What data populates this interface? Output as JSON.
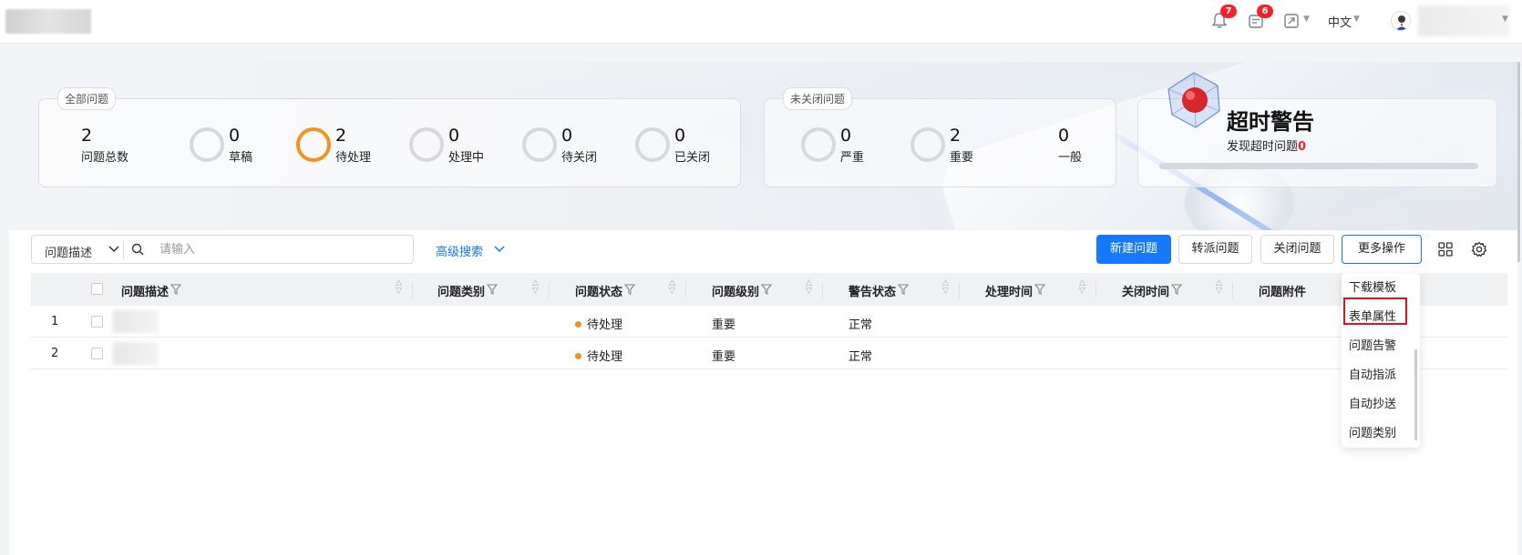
{
  "header": {
    "notification_count": "7",
    "task_count": "6",
    "language": "中文"
  },
  "all_issues": {
    "tag": "全部问题",
    "stats": [
      {
        "value": "2",
        "label": "问题总数"
      },
      {
        "value": "0",
        "label": "草稿"
      },
      {
        "value": "2",
        "label": "待处理"
      },
      {
        "value": "0",
        "label": "处理中"
      },
      {
        "value": "0",
        "label": "待关闭"
      },
      {
        "value": "0",
        "label": "已关闭"
      }
    ]
  },
  "open_issues": {
    "tag": "未关闭问题",
    "stats": [
      {
        "value": "0",
        "label": "严重"
      },
      {
        "value": "2",
        "label": "重要"
      },
      {
        "value": "0",
        "label": "一般"
      }
    ]
  },
  "timeout": {
    "title": "超时警告",
    "subtitle": "发现超时问题",
    "count": "0"
  },
  "search": {
    "field": "问题描述",
    "placeholder": "请输入",
    "advanced": "高级搜索"
  },
  "toolbar": {
    "new": "新建问题",
    "assign": "转派问题",
    "close": "关闭问题",
    "more": "更多操作"
  },
  "table": {
    "columns": [
      "问题描述",
      "问题类别",
      "问题状态",
      "问题级别",
      "警告状态",
      "处理时间",
      "关闭时间",
      "问题附件"
    ],
    "rows": [
      {
        "index": "1",
        "status": "待处理",
        "level": "重要",
        "warning": "正常"
      },
      {
        "index": "2",
        "status": "待处理",
        "level": "重要",
        "warning": "正常"
      }
    ]
  },
  "more_menu": {
    "items": [
      "下载模板",
      "表单属性",
      "问题告警",
      "自动指派",
      "自动抄送",
      "问题类别"
    ]
  },
  "colors": {
    "primary": "#1677ff",
    "pending": "#f0941c",
    "badge": "#f5222d",
    "highlight": "#e0121f"
  }
}
